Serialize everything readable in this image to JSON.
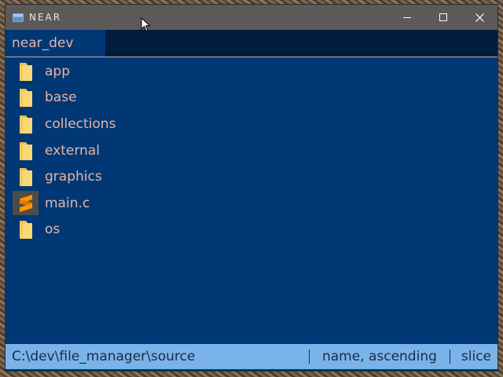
{
  "window": {
    "title": "NEAR",
    "minimize_icon": "minimize-icon",
    "maximize_icon": "maximize-icon",
    "close_icon": "close-icon"
  },
  "tabs": [
    {
      "label": "near_dev"
    }
  ],
  "files": [
    {
      "name": "app",
      "icon": "folder-icon"
    },
    {
      "name": "base",
      "icon": "folder-icon"
    },
    {
      "name": "collections",
      "icon": "folder-icon"
    },
    {
      "name": "external",
      "icon": "folder-icon"
    },
    {
      "name": "graphics",
      "icon": "folder-icon"
    },
    {
      "name": "main.c",
      "icon": "sublime-file-icon"
    },
    {
      "name": "os",
      "icon": "folder-icon"
    }
  ],
  "status": {
    "path": "C:\\dev\\file_manager\\source",
    "sort": "name, ascending",
    "mode": "slice"
  },
  "colors": {
    "panel_bg": "#003775",
    "tabbar_bg": "#021c3d",
    "titlebar_bg": "#5c5a58",
    "text": "#e8b4a4",
    "statusbar_bg": "#7ab3ea",
    "folder": "#f8d775"
  }
}
